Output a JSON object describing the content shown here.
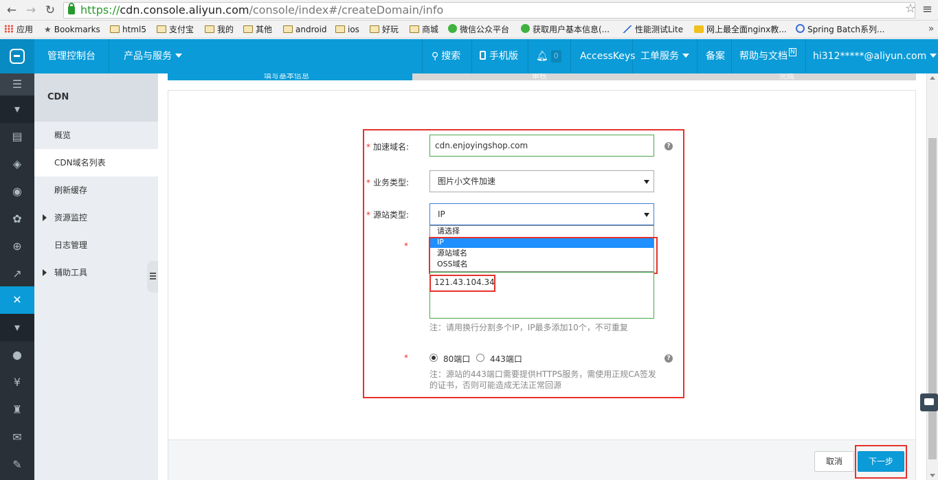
{
  "browser": {
    "url_scheme": "https://",
    "url_domain": "cdn.console.aliyun.com",
    "url_path": "/console/index#/createDomain/info",
    "bookmarks": [
      {
        "label": "应用",
        "icon": "apps-icon"
      },
      {
        "label": "Bookmarks",
        "icon": "star-icon"
      },
      {
        "label": "html5",
        "icon": "folder-icon"
      },
      {
        "label": "支付宝",
        "icon": "folder-icon"
      },
      {
        "label": "我的",
        "icon": "folder-icon"
      },
      {
        "label": "其他",
        "icon": "folder-icon"
      },
      {
        "label": "android",
        "icon": "folder-icon"
      },
      {
        "label": "ios",
        "icon": "folder-icon"
      },
      {
        "label": "好玩",
        "icon": "folder-icon"
      },
      {
        "label": "商城",
        "icon": "folder-icon"
      },
      {
        "label": "微信公众平台",
        "icon": "wechat-icon"
      },
      {
        "label": "获取用户基本信息(...",
        "icon": "wechat-icon"
      },
      {
        "label": "性能测试Lite",
        "icon": "chart-icon"
      },
      {
        "label": "网上最全面nginx教...",
        "icon": "cup-icon"
      },
      {
        "label": "Spring Batch系列...",
        "icon": "globe-icon"
      }
    ]
  },
  "topnav": {
    "console_label": "管理控制台",
    "products_label": "产品与服务",
    "search_label": "搜索",
    "mobile_label": "手机版",
    "bell_count": "0",
    "accesskeys_label": "AccessKeys",
    "ticket_label": "工单服务",
    "beian_label": "备案",
    "help_label": "帮助与文档",
    "help_badge": "N",
    "account_label": "hi312*****@aliyun.com"
  },
  "sidebar": {
    "title": "CDN",
    "items": [
      {
        "label": "概览"
      },
      {
        "label": "CDN域名列表"
      },
      {
        "label": "刷新缓存"
      },
      {
        "label": "资源监控"
      },
      {
        "label": "日志管理"
      },
      {
        "label": "辅助工具"
      }
    ]
  },
  "steps": [
    "填写基本信息",
    "审核",
    "完成"
  ],
  "form": {
    "domain_label": "加速域名:",
    "domain_value": "cdn.enjoyingshop.com",
    "business_label": "业务类型:",
    "business_value": "图片小文件加速",
    "origin_label": "源站类型:",
    "origin_value": "IP",
    "origin_options": [
      "请选择",
      "IP",
      "源站域名",
      "OSS域名"
    ],
    "ip_value": "121.43.104.34",
    "ip_note": "注：请用换行分割多个IP，IP最多添加10个，不可重复",
    "port80_label": "80端口",
    "port443_label": "443端口",
    "port_note_line1": "注：源站的443端口需要提供HTTPS服务，需使用正规CA签发",
    "port_note_line2": "的证书，否则可能造成无法正常回源",
    "required_mark": "*",
    "help_mark": "?"
  },
  "footer": {
    "cancel_label": "取消",
    "next_label": "下一步"
  },
  "colors": {
    "brand": "#0a9bd8",
    "highlight": "#e5312b",
    "rail": "#293038"
  }
}
